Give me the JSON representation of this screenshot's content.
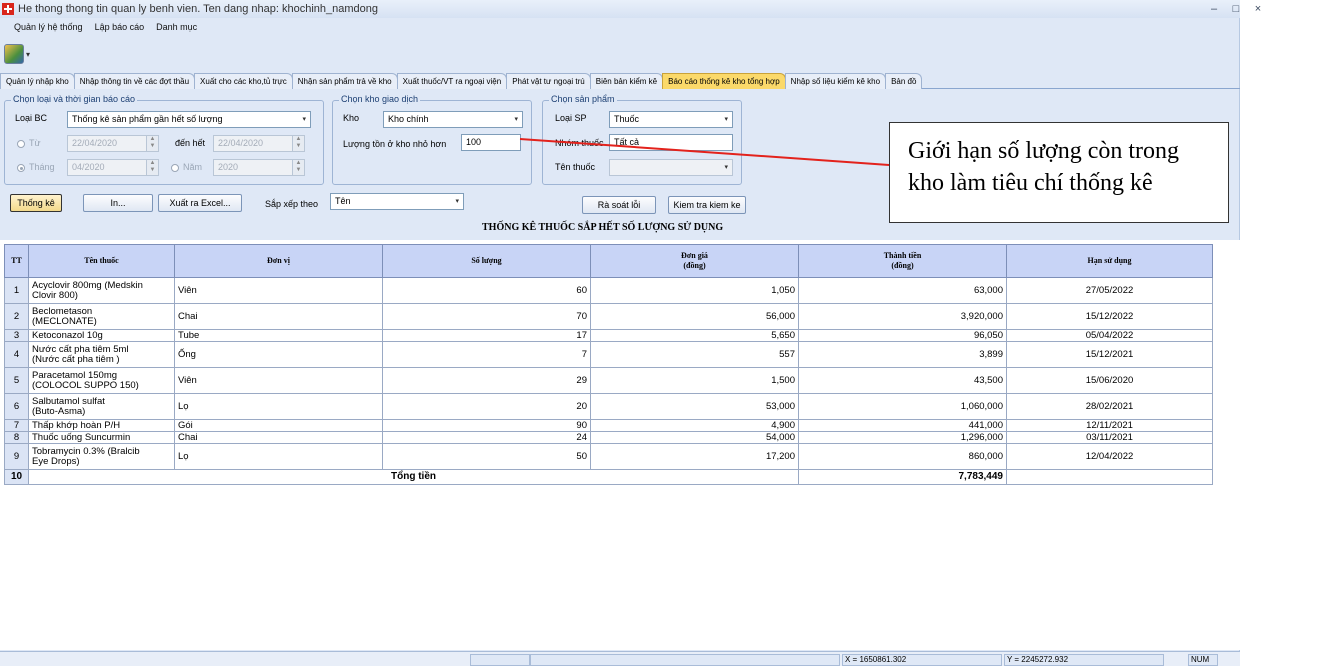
{
  "window": {
    "title": "He thong thong tin quan ly benh vien. Ten dang nhap: khochinh_namdong",
    "controls": [
      "–",
      "□",
      "×"
    ]
  },
  "menu": [
    "Quản lý hệ thống",
    "Lập báo cáo",
    "Danh mục"
  ],
  "tabs": [
    {
      "label": "Quản lý nhập kho",
      "active": false
    },
    {
      "label": "Nhập thông tin về các đợt thầu",
      "active": false
    },
    {
      "label": "Xuất cho các kho,tủ trực",
      "active": false
    },
    {
      "label": "Nhận sản phẩm trả về kho",
      "active": false
    },
    {
      "label": "Xuất thuốc/VT ra ngoại viện",
      "active": false
    },
    {
      "label": "Phát vật tư ngoại trú",
      "active": false
    },
    {
      "label": "Biên bản kiểm kê",
      "active": false
    },
    {
      "label": "Báo cáo thống kê kho tổng hợp",
      "active": true
    },
    {
      "label": "Nhập số liệu kiểm kê kho",
      "active": false
    },
    {
      "label": "Bản đồ",
      "active": false
    }
  ],
  "report_group": {
    "legend": "Chọn loại và thời gian báo cáo",
    "loai_bc_label": "Loại BC",
    "loai_bc_value": "Thống kê sản phẩm gần hết số lượng",
    "tu_label": "Từ",
    "tu_value": "22/04/2020",
    "den_het_label": "đến hết",
    "den_het_value": "22/04/2020",
    "thang_label": "Tháng",
    "thang_value": "04/2020",
    "nam_label": "Năm",
    "nam_value": "2020"
  },
  "kho_group": {
    "legend": "Chọn kho giao dịch",
    "kho_label": "Kho",
    "kho_value": "Kho chính",
    "luong_ton_label": "Lượng tồn ở kho nhỏ hơn",
    "luong_ton_value": "100"
  },
  "sp_group": {
    "legend": "Chọn sản phẩm",
    "loai_sp_label": "Loại SP",
    "loai_sp_value": "Thuốc",
    "nhom_thuoc_label": "Nhóm thuốc",
    "nhom_thuoc_value": "Tất cả",
    "ten_thuoc_label": "Tên thuốc",
    "ten_thuoc_value": ""
  },
  "buttons": {
    "thong_ke": "Thống kê",
    "in": "In...",
    "xuat_excel": "Xuất ra Excel...",
    "sap_xep_label": "Sắp xếp theo",
    "sap_xep_value": "Tên",
    "ra_soat": "Rà soát lỗi",
    "kiem_tra": "Kiem tra kiem ke"
  },
  "report_title": "THỐNG KÊ THUỐC SẮP HẾT SỐ LƯỢNG SỬ DỤNG",
  "table": {
    "headers": {
      "tt": "TT",
      "ten": "Tên thuốc",
      "don_vi": "Đơn vị",
      "so_luong": "Số lượng",
      "don_gia_1": "Đơn giá",
      "don_gia_2": "(đồng)",
      "thanh_tien_1": "Thành tiền",
      "thanh_tien_2": "(đồng)",
      "han": "Hạn sử dụng"
    },
    "rows": [
      {
        "tt": "1",
        "ten_1": "Acyclovir 800mg (Medskin",
        "ten_2": "Clovir 800)",
        "don_vi": "Viên",
        "so_luong": "60",
        "don_gia": "1,050",
        "thanh_tien": "63,000",
        "han": "27/05/2022"
      },
      {
        "tt": "2",
        "ten_1": "Beclometason",
        "ten_2": "(MECLONATE)",
        "don_vi": "Chai",
        "so_luong": "70",
        "don_gia": "56,000",
        "thanh_tien": "3,920,000",
        "han": "15/12/2022"
      },
      {
        "tt": "3",
        "ten_1": "Ketoconazol 10g",
        "ten_2": "",
        "don_vi": "Tube",
        "so_luong": "17",
        "don_gia": "5,650",
        "thanh_tien": "96,050",
        "han": "05/04/2022"
      },
      {
        "tt": "4",
        "ten_1": "Nước cất pha tiêm 5ml",
        "ten_2": "(Nước cất pha tiêm )",
        "don_vi": "Ống",
        "so_luong": "7",
        "don_gia": "557",
        "thanh_tien": "3,899",
        "han": "15/12/2021"
      },
      {
        "tt": "5",
        "ten_1": "Paracetamol 150mg",
        "ten_2": "(COLOCOL SUPPO 150)",
        "don_vi": "Viên",
        "so_luong": "29",
        "don_gia": "1,500",
        "thanh_tien": "43,500",
        "han": "15/06/2020"
      },
      {
        "tt": "6",
        "ten_1": "Salbutamol sulfat",
        "ten_2": "(Buto-Asma)",
        "don_vi": "Lọ",
        "so_luong": "20",
        "don_gia": "53,000",
        "thanh_tien": "1,060,000",
        "han": "28/02/2021"
      },
      {
        "tt": "7",
        "ten_1": "Thấp khớp hoàn P/H",
        "ten_2": "",
        "don_vi": "Gói",
        "so_luong": "90",
        "don_gia": "4,900",
        "thanh_tien": "441,000",
        "han": "12/11/2021"
      },
      {
        "tt": "8",
        "ten_1": "Thuốc uống Suncurmin",
        "ten_2": "",
        "don_vi": "Chai",
        "so_luong": "24",
        "don_gia": "54,000",
        "thanh_tien": "1,296,000",
        "han": "03/11/2021"
      },
      {
        "tt": "9",
        "ten_1": "Tobramycin 0.3% (Bralcib",
        "ten_2": "Eye Drops)",
        "don_vi": "Lọ",
        "so_luong": "50",
        "don_gia": "17,200",
        "thanh_tien": "860,000",
        "han": "12/04/2022"
      }
    ],
    "total": {
      "tt": "10",
      "label": "Tổng tiền",
      "value": "7,783,449"
    }
  },
  "status": {
    "x": "X = 1650861.302",
    "y": "Y = 2245272.932",
    "num": "NUM"
  },
  "callout": {
    "line1": "Giới hạn số lượng còn trong",
    "line2": "kho làm tiêu chí thống kê",
    "color": "#e3221c"
  }
}
